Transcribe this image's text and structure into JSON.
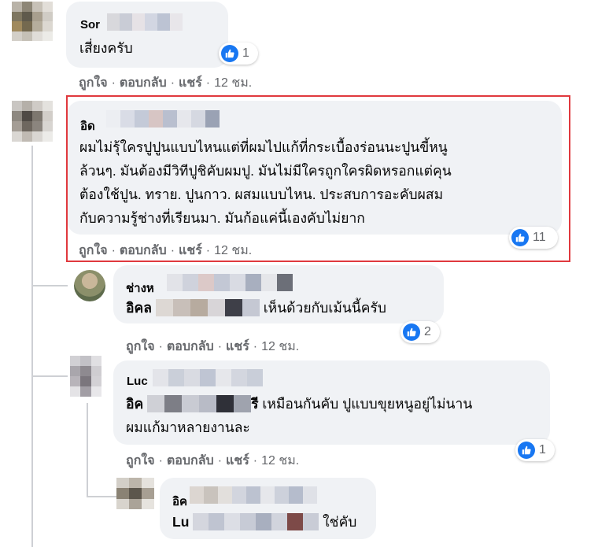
{
  "comments": [
    {
      "author_visible": "Sor",
      "text": "เสี่ยงครับ",
      "likes": "1",
      "actions": {
        "like": "ถูกใจ",
        "reply": "ตอบกลับ",
        "share": "แชร์",
        "time": "12 ชม."
      }
    },
    {
      "author_visible": "อิด",
      "text": "ผมไม่รุ้ใครปูปูนแบบไหนแต่ที่ผมไปแก้ที่กระเบื้องร่อนนะปูนขี้หนู\nล้วนๆ. มันต้องมีวิทีปูชิคับผมปู. มันไม่มีใครถูกใครผิดหรอกแต่คุน\nต้องใช้ปูน. ทราย. ปูนกาว. ผสมแบบไหน. ประสบการอะคับผสม\nกับความรู้ช่างที่เรียนมา. มันก้อแค่นี้เองคับไม่ยาก",
      "likes": "11",
      "actions": {
        "like": "ถูกใจ",
        "reply": "ตอบกลับ",
        "share": "แชร์",
        "time": "12 ชม."
      }
    }
  ],
  "replies": [
    {
      "author_visible": "ช่างห",
      "mention_visible": "อิคล",
      "text": "เห็นด้วยกับเม้นนี้ครับ",
      "likes": "2",
      "actions": {
        "like": "ถูกใจ",
        "reply": "ตอบกลับ",
        "share": "แชร์",
        "time": "12 ชม."
      }
    },
    {
      "author_visible": "Luc",
      "mention_visible": "อิค",
      "mention_tail": "รี",
      "text_line1": "เหมือนกันคับ ปูแบบขุยหนูอยู่ไม่นาน",
      "text_line2": "ผมแก้มาหลายงานละ",
      "likes": "1",
      "actions": {
        "like": "ถูกใจ",
        "reply": "ตอบกลับ",
        "share": "แชร์",
        "time": "12 ชม."
      }
    },
    {
      "author_visible": "อิค",
      "mention_visible": "Lu",
      "text": "ใช่คับ"
    }
  ],
  "icons": {
    "like_reaction": "thumbs-up-icon"
  },
  "colors": {
    "highlight_border": "#e0393e",
    "bubble": "#f0f2f5",
    "like_blue": "#1877f2",
    "meta_text": "#65676b"
  }
}
